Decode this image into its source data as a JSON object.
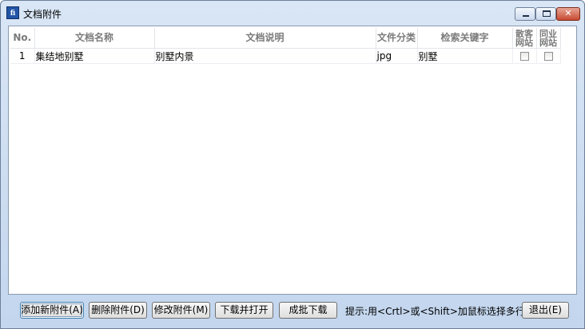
{
  "window": {
    "title": "文档附件",
    "app_icon_text": "fi",
    "minimize_icon": "minimize-icon",
    "maximize_icon": "maximize-icon",
    "close_icon": "close-icon"
  },
  "table": {
    "headers": [
      "No.",
      "文档名称",
      "文档说明",
      "文件分类",
      "检索关键字",
      "散客\n网站",
      "同业\n网站"
    ],
    "rows": [
      {
        "no": "1",
        "name": "集结地别墅",
        "desc": "别墅内景",
        "type": "jpg",
        "keywords": "别墅",
        "retail_site": false,
        "trade_site": false
      }
    ]
  },
  "buttons": {
    "add": "添加新附件(A)",
    "delete": "删除附件(D)",
    "modify": "修改附件(M)",
    "download_open": "下载并打开",
    "batch_download": "成批下载",
    "exit": "退出(E)"
  },
  "hint": "提示:用<Crtl>或<Shift>加鼠标选择多行"
}
